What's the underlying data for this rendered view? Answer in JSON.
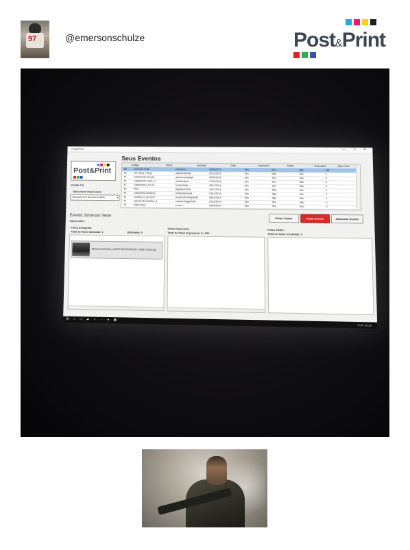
{
  "header": {
    "username": "@emersonschulze",
    "avatar_number": "97",
    "logo_text": "Post",
    "logo_amp": "&",
    "logo_text2": "Print",
    "logo_colors": [
      "#29a8e0",
      "#e4197c",
      "#f7d117",
      "#231f20",
      "#d7262b",
      "#3bab49",
      "#3a53a4"
    ]
  },
  "app": {
    "window_title": "Post&Print",
    "window_controls": "— □ ✕",
    "logo": "Post&Print",
    "version": "Versão 3.0",
    "printer_label": "Selecionar Impressora",
    "printer_value": "Microsoft XPS Document Writer",
    "section_title": "Seus Eventos",
    "table": {
      "columns": [
        "Código",
        "Nome",
        "Hashtag",
        "Data",
        "Impressão",
        "Twitter",
        "Automatico",
        "Qtde Fotos"
      ],
      "rows": [
        [
          "58",
          "Emerson Teste",
          "emerson.t",
          "05/08/2015",
          "Sim",
          "Sim",
          "Não",
          "122"
        ],
        [
          "52",
          "Ala Tosca e Brejo",
          "aladoscaebrejo",
          "02/11/2015",
          "Sim",
          "Não",
          "Sim",
          "3"
        ],
        [
          "51",
          "Casamento Ana gel",
          "gaemersonyiagel",
          "05/09/2015",
          "Sim",
          "Sim",
          "Sim",
          "0"
        ],
        [
          "48",
          "Casamento Paulo e J",
          "paulinhojane",
          "17/04/2015",
          "Sim",
          "Sim",
          "Sim",
          "0"
        ],
        [
          "47",
          "Casamento La e Ka",
          "lucasmanila",
          "28/12/2014",
          "Sim",
          "Sim",
          "Não",
          "0"
        ],
        [
          "46",
          "PDG",
          "pdgeldummies",
          "16/12/2014",
          "Sim",
          "Não",
          "Sim",
          "0"
        ],
        [
          "45",
          "Casamento Moisés e",
          "moisesestrunda",
          "15/11/2014",
          "Sim",
          "Não",
          "Sim",
          "0"
        ],
        [
          "45",
          "lucasta.p e .gu 2014",
          "lucasmomentegatadu",
          "08/10/2014",
          "Sim",
          "Não",
          "Sim",
          "0"
        ],
        [
          "44",
          "casamento priscila e g",
          "casamentogpriscila",
          "06/11/2014",
          "Sim",
          "Sim",
          "Não",
          "0"
        ],
        [
          "43",
          "zoltan teste",
          "zoxzor",
          "23/03/2014",
          "Sim",
          "Sim",
          "Sim",
          "0"
        ]
      ]
    },
    "buttons": {
      "edit": "Editar Twitter",
      "stop": "Parar Evento",
      "add": "Adicionar Evento"
    },
    "event_name": "Evento:  Emerson Teste",
    "event_sub": "Impressões",
    "panel_left": {
      "title": "Fotos Instagram",
      "total_label": "Total de fotos baixadas: 1",
      "used_label": "Utilizadas: 0",
      "item_text": "@emersonschulze_1005713253752361657_2956174302.jpg"
    },
    "panel_mid": {
      "title": "Fotos Impressas",
      "total_label": "Total de fotos impressas: 0 / 900"
    },
    "panel_right": {
      "title": "Fotos Twitter",
      "total_label": "Total de fotos recebidas: 0"
    },
    "taskbar": {
      "tray": "POR  16:36"
    }
  }
}
